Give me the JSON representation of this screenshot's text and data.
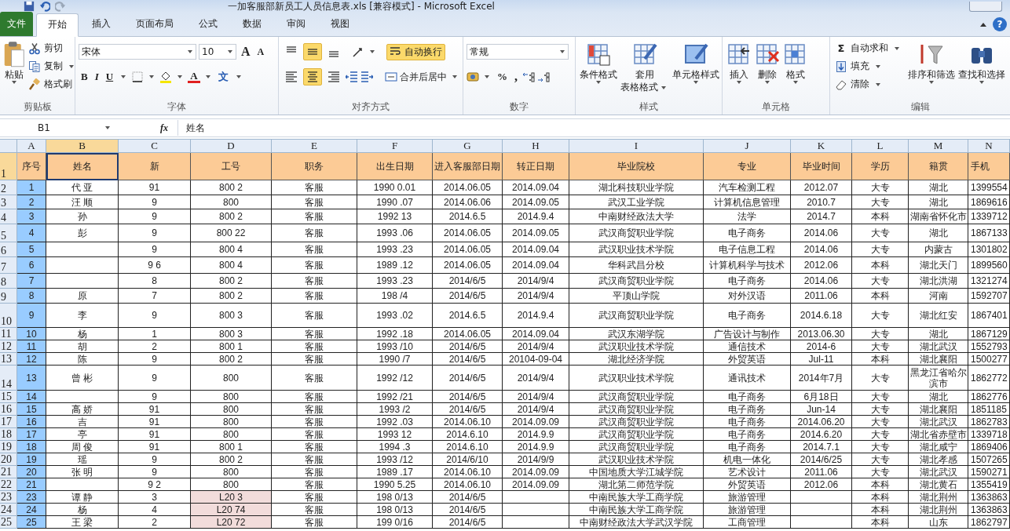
{
  "window": {
    "title": "一加客服部新员工人员信息表.xls  [兼容模式]  -  Microsoft Excel",
    "help": "?"
  },
  "tabs": [
    {
      "label": "文件",
      "kind": "file",
      "selected": false
    },
    {
      "label": "开始",
      "kind": "tab",
      "selected": true
    },
    {
      "label": "插入",
      "kind": "tab",
      "selected": false
    },
    {
      "label": "页面布局",
      "kind": "tab",
      "selected": false
    },
    {
      "label": "公式",
      "kind": "tab",
      "selected": false
    },
    {
      "label": "数据",
      "kind": "tab",
      "selected": false
    },
    {
      "label": "审阅",
      "kind": "tab",
      "selected": false
    },
    {
      "label": "视图",
      "kind": "tab",
      "selected": false
    }
  ],
  "ribbon_groups": [
    {
      "kind": "clipboard",
      "label": "剪贴板",
      "paste": "粘贴",
      "items": [
        {
          "kind": "cut",
          "label": "剪切"
        },
        {
          "kind": "copy",
          "label": "复制"
        },
        {
          "kind": "format_painter",
          "label": "格式刷"
        }
      ]
    },
    {
      "kind": "font",
      "label": "字体",
      "font": "宋体",
      "size": "10",
      "grow": "A",
      "shrink": "A",
      "styles": [
        "B",
        "I",
        "U"
      ],
      "font_color": "A",
      "phonetic": "文"
    },
    {
      "kind": "alignment",
      "label": "对齐方式",
      "vertical": [
        {
          "on": false
        },
        {
          "on": true
        },
        {
          "on": false
        }
      ],
      "horizontal": [
        {
          "on": false
        },
        {
          "on": true
        },
        {
          "on": false
        }
      ],
      "wrap_text": {
        "label": "自动换行",
        "on": true
      },
      "merge": "合并后居中"
    },
    {
      "kind": "number",
      "label": "数字",
      "format": "常规",
      "percent": "%",
      "comma": ","
    },
    {
      "kind": "large",
      "label": "样式",
      "buttons": [
        {
          "kind": "conditional",
          "lines": [
            "条件格式"
          ]
        },
        {
          "kind": "table_style",
          "lines": [
            "套用",
            "表格格式"
          ]
        },
        {
          "kind": "cell_style",
          "lines": [
            "单元格样式"
          ]
        }
      ]
    },
    {
      "kind": "large",
      "label": "单元格",
      "buttons": [
        {
          "kind": "insert",
          "lines": [
            "插入"
          ]
        },
        {
          "kind": "delete",
          "lines": [
            "删除"
          ]
        },
        {
          "kind": "format",
          "lines": [
            "格式"
          ]
        }
      ]
    },
    {
      "kind": "editing",
      "label": "编辑",
      "items": [
        {
          "kind": "sum",
          "symbol": "Σ",
          "label": "自动求和"
        },
        {
          "kind": "fill",
          "label": "填充"
        },
        {
          "kind": "clear",
          "label": "清除"
        }
      ],
      "buttons": [
        {
          "kind": "sort",
          "lines": [
            "排序和筛选"
          ]
        },
        {
          "kind": "find",
          "lines": [
            "查找和选择"
          ]
        }
      ]
    }
  ],
  "formula_bar": {
    "name_box": "B1",
    "function_label": "fx",
    "formula": "姓名"
  },
  "sheet": {
    "columns": [
      {
        "letter": "A",
        "selected": false
      },
      {
        "letter": "B",
        "selected": true
      },
      {
        "letter": "C",
        "selected": false
      },
      {
        "letter": "D",
        "selected": false
      },
      {
        "letter": "E",
        "selected": false
      },
      {
        "letter": "F",
        "selected": false
      },
      {
        "letter": "G",
        "selected": false
      },
      {
        "letter": "H",
        "selected": false
      },
      {
        "letter": "I",
        "selected": false
      },
      {
        "letter": "J",
        "selected": false
      },
      {
        "letter": "K",
        "selected": false
      },
      {
        "letter": "L",
        "selected": false
      },
      {
        "letter": "M",
        "selected": false
      },
      {
        "letter": "N",
        "selected": false
      }
    ],
    "rows": [
      {
        "number": "1",
        "kind": "heading",
        "selected": true,
        "id_shaded": false,
        "cells": [
          "序号",
          "姓名",
          "新",
          "工号",
          "职务",
          "出生日期",
          "进入客服部日期",
          "转正日期",
          "毕业院校",
          "专业",
          "毕业时间",
          "学历",
          "籍贯",
          "手机"
        ]
      },
      {
        "number": "2",
        "kind": "data",
        "selected": false,
        "id_shaded": false,
        "cells": [
          "1",
          "代 亚",
          "91",
          "800 2",
          "客服",
          "1990 0.01",
          "2014.06.05",
          "2014.09.04",
          "湖北科技职业学院",
          "汽车检测工程",
          "2012.07",
          "大专",
          "湖北",
          "1399554"
        ]
      },
      {
        "number": "3",
        "kind": "data",
        "selected": false,
        "id_shaded": false,
        "cells": [
          "2",
          "汪 顺",
          "9",
          "800",
          "客服",
          "1990 .07",
          "2014.06.06",
          "2014.09.05",
          "武汉工业学院",
          "计算机信息管理",
          "2010.7",
          "大专",
          "湖北",
          "1869616"
        ]
      },
      {
        "number": "4",
        "kind": "data",
        "selected": false,
        "id_shaded": false,
        "cells": [
          "3",
          "孙",
          "9",
          "800 2",
          "客服",
          "1992 13",
          "2014.6.5",
          "2014.9.4",
          "中南财经政法大学",
          "法学",
          "2014.7",
          "本科",
          "湖南省怀化市",
          "1339712"
        ]
      },
      {
        "number": "5",
        "kind": "data",
        "selected": false,
        "id_shaded": false,
        "cells": [
          "4",
          "彭",
          "9",
          "800 22",
          "客服",
          "1993 .06",
          "2014.06.05",
          "2014.09.05",
          "武汉商贸职业学院",
          "电子商务",
          "2014.06",
          "大专",
          "湖北",
          "1867133"
        ]
      },
      {
        "number": "6",
        "kind": "data",
        "selected": false,
        "id_shaded": false,
        "cells": [
          "5",
          null,
          "9",
          "800 4",
          "客服",
          "1993 .23",
          "2014.06.05",
          "2014.09.04",
          "武汉职业技术学院",
          "电子信息工程",
          "2014.06",
          "大专",
          "内蒙古",
          "1301802"
        ]
      },
      {
        "number": "7",
        "kind": "data",
        "selected": false,
        "id_shaded": false,
        "cells": [
          "6",
          null,
          "9 6",
          "800 4",
          "客服",
          "1989 .12",
          "2014.06.05",
          "2014.09.04",
          "华科武昌分校",
          "计算机科学与技术",
          "2012.06",
          "本科",
          "湖北天门",
          "1899560"
        ]
      },
      {
        "number": "8",
        "kind": "data",
        "selected": false,
        "id_shaded": false,
        "cells": [
          "7",
          null,
          "8",
          "800 2",
          "客服",
          "1993 .23",
          "2014/6/5",
          "2014/9/4",
          "武汉商贸职业学院",
          "电子商务",
          "2014.06",
          "大专",
          "湖北洪湖",
          "1321274"
        ]
      },
      {
        "number": "9",
        "kind": "data",
        "selected": false,
        "id_shaded": false,
        "cells": [
          "8",
          "原",
          "7",
          "800 2",
          "客服",
          "198 /4",
          "2014/6/5",
          "2014/9/4",
          "平顶山学院",
          "对外汉语",
          "2011.06",
          "本科",
          "河南",
          "1592707"
        ]
      },
      {
        "number": "10",
        "kind": "data",
        "selected": false,
        "id_shaded": false,
        "cells": [
          "9",
          "李",
          "9",
          "800 3",
          "客服",
          "1993 .02",
          "2014.6.5",
          "2014.9.4",
          "武汉商贸职业学院",
          "电子商务",
          "2014.6.18",
          "大专",
          "湖北红安",
          "1867401"
        ]
      },
      {
        "number": "11",
        "kind": "data",
        "selected": false,
        "id_shaded": false,
        "cells": [
          "10",
          "杨",
          "1",
          "800 3",
          "客服",
          "1992 .18",
          "2014.06.05",
          "2014.09.04",
          "武汉东湖学院",
          "广告设计与制作",
          "2013.06.30",
          "大专",
          "湖北",
          "1867129"
        ]
      },
      {
        "number": "12",
        "kind": "data",
        "selected": false,
        "id_shaded": false,
        "cells": [
          "11",
          "胡",
          "2",
          "800 1",
          "客服",
          "1993 /10",
          "2014/6/5",
          "2014/9/4",
          "武汉职业技术学院",
          "通信技术",
          "2014-6",
          "大专",
          "湖北武汉",
          "1552793"
        ]
      },
      {
        "number": "13",
        "kind": "data",
        "selected": false,
        "id_shaded": false,
        "cells": [
          "12",
          "陈",
          "9",
          "800 2",
          "客服",
          "1990 /7",
          "2014/6/5",
          "20104-09-04",
          "湖北经济学院",
          "外贸英语",
          "Jul-11",
          "本科",
          "湖北襄阳",
          "1500277"
        ]
      },
      {
        "number": "14",
        "kind": "data",
        "selected": false,
        "id_shaded": false,
        "cells": [
          "13",
          "曾 彬",
          "9",
          "800",
          "客服",
          "1992 /12",
          "2014/6/5",
          "2014/9/4",
          "武汉职业技术学院",
          "通讯技术",
          "2014年7月",
          "大专",
          "黑龙江省哈尔滨市",
          "1862772"
        ]
      },
      {
        "number": "15",
        "kind": "data",
        "selected": false,
        "id_shaded": false,
        "cells": [
          "14",
          null,
          "9",
          "800",
          "客服",
          "1992 /21",
          "2014/6/5",
          "2014/9/4",
          "武汉商贸职业学院",
          "电子商务",
          "6月18日",
          "大专",
          "湖北",
          "1862776"
        ]
      },
      {
        "number": "16",
        "kind": "data",
        "selected": false,
        "id_shaded": false,
        "cells": [
          "15",
          "高 娇",
          "91",
          "800",
          "客服",
          "1993 /2",
          "2014/6/5",
          "2014/9/4",
          "武汉商贸职业学院",
          "电子商务",
          "Jun-14",
          "大专",
          "湖北襄阳",
          "1851185"
        ]
      },
      {
        "number": "17",
        "kind": "data",
        "selected": false,
        "id_shaded": false,
        "cells": [
          "16",
          "吉",
          "91",
          "800",
          "客服",
          "1992 .03",
          "2014.06.10",
          "2014.09.09",
          "武汉商贸职业学院",
          "电子商务",
          "2014.06.20",
          "大专",
          "湖北武汉",
          "1862783"
        ]
      },
      {
        "number": "18",
        "kind": "data",
        "selected": false,
        "id_shaded": false,
        "cells": [
          "17",
          "亭",
          "91",
          "800",
          "客服",
          "1993 12",
          "2014.6.10",
          "2014.9.9",
          "武汉商贸职业学院",
          "电子商务",
          "2014.6.20",
          "大专",
          "湖北省赤壁市",
          "1339718"
        ]
      },
      {
        "number": "19",
        "kind": "data",
        "selected": false,
        "id_shaded": false,
        "cells": [
          "18",
          "周 俊",
          "91",
          "800 1",
          "客服",
          "1994 .3",
          "2014.6.10",
          "2014.9.9",
          "武汉商贸职业学院",
          "电子商务",
          "2014.7.1",
          "大专",
          "湖北咸宁",
          "1869406"
        ]
      },
      {
        "number": "20",
        "kind": "data",
        "selected": false,
        "id_shaded": false,
        "cells": [
          "19",
          "瑶",
          "9",
          "800 2",
          "客服",
          "1993 /12",
          "2014/6/10",
          "2014/9/9",
          "武汉职业技术学院",
          "机电一体化",
          "2014/6/25",
          "大专",
          "湖北孝感",
          "1507265"
        ]
      },
      {
        "number": "21",
        "kind": "data",
        "selected": false,
        "id_shaded": false,
        "cells": [
          "20",
          "张 明",
          "9",
          "800",
          "客服",
          "1989 .17",
          "2014.06.10",
          "2014.09.09",
          "中国地质大学江城学院",
          "艺术设计",
          "2011.06",
          "大专",
          "湖北武汉",
          "1590271"
        ]
      },
      {
        "number": "22",
        "kind": "data",
        "selected": false,
        "id_shaded": false,
        "cells": [
          "21",
          null,
          "9 2",
          "800",
          "客服",
          "1990 5.25",
          "2014.06.10",
          "2014.09.09",
          "湖北第二师范学院",
          "外贸英语",
          "2012.06",
          "本科",
          "湖北黄石",
          "1355419"
        ]
      },
      {
        "number": "23",
        "kind": "data",
        "selected": false,
        "id_shaded": true,
        "cells": [
          "23",
          "谭 静",
          "3",
          "L20 3",
          "客服",
          "198 0/13",
          "2014/6/5",
          null,
          "中南民族大学工商学院",
          "旅游管理",
          null,
          "本科",
          "湖北荆州",
          "1363863"
        ]
      },
      {
        "number": "24",
        "kind": "data",
        "selected": false,
        "id_shaded": true,
        "cells": [
          "24",
          "杨",
          "4",
          "L20 74",
          "客服",
          "198 0/13",
          "2014/6/5",
          null,
          "中南民族大学工商学院",
          "旅游管理",
          null,
          "本科",
          "湖北荆州",
          "1363863"
        ]
      },
      {
        "number": "25",
        "kind": "data",
        "selected": false,
        "id_shaded": true,
        "cells": [
          "25",
          "王 梁",
          "2",
          "L20 72",
          "客服",
          "199 0/16",
          "2014/6/5",
          null,
          "中南财经政法大学武汉学院",
          "工商管理",
          null,
          "本科",
          "山东",
          "1862797"
        ]
      }
    ]
  }
}
